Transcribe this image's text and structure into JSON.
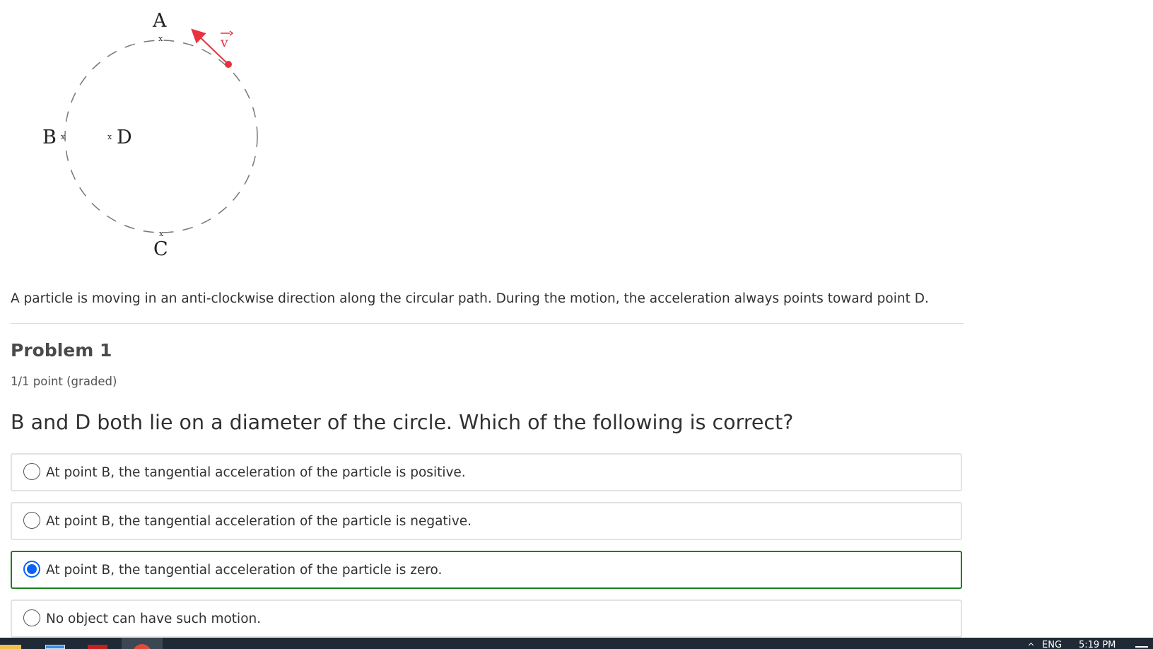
{
  "diagram": {
    "label_a": "A",
    "label_b": "B",
    "label_c": "C",
    "label_d": "D",
    "label_v": "v",
    "marker": "x",
    "velocity_color": "#e8323f"
  },
  "problem": {
    "intro": "A particle is moving in an anti-clockwise direction along the circular path. During the motion, the acceleration always points toward point D.",
    "title": "Problem 1",
    "points": "1/1 point (graded)",
    "question": "B and D both lie on a diameter of the circle. Which of the following is correct?",
    "options": [
      {
        "label": "At point B, the tangential acceleration of the particle is positive.",
        "selected": false
      },
      {
        "label": "At point B, the tangential acceleration of the particle is negative.",
        "selected": false
      },
      {
        "label": "At point B, the tangential acceleration of the particle is zero.",
        "selected": true
      },
      {
        "label": "No object can have such motion.",
        "selected": false
      }
    ],
    "correct_border_color": "#178117",
    "radio_selected_color": "#0b63f6"
  },
  "taskbar": {
    "language": "ENG",
    "time": "5:19 PM",
    "icons": [
      "folder-icon",
      "app-icon",
      "acrobat-icon",
      "chrome-icon"
    ]
  }
}
